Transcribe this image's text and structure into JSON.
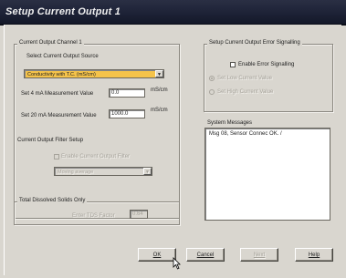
{
  "window": {
    "title": "Setup Current Output 1"
  },
  "channel_group": {
    "label": "Current Output Channel 1",
    "source_label": "Select Current Output Source",
    "source_value": "Conductivity with T.C. (mS/cm)",
    "row_4ma": {
      "label": "Set 4 mA Measurement Value",
      "value": "0.0",
      "unit": "mS/cm"
    },
    "row_20ma": {
      "label": "Set 20 mA Measurement Value",
      "value": "1000.0",
      "unit": "mS/cm"
    }
  },
  "filter_group": {
    "label": "Current Output Filter Setup",
    "checkbox_label": "Enable Current Output Filter",
    "select_value": "Moving average"
  },
  "tds_group": {
    "label": "Total Dissolved Solids Only",
    "factor_label": "Enter TDS Factor",
    "factor_value": "0.64"
  },
  "error_group": {
    "label": "Setup Current Output Error Signalling",
    "enable_label": "Enable Error Signalling",
    "radio1_label": "Set Low Current Value",
    "radio2_label": "Set High Current Value"
  },
  "messages": {
    "label": "System Messages",
    "text": "Msg 08, Sensor Connec OK. /"
  },
  "buttons": {
    "ok": "OK",
    "cancel": "Cancel",
    "next": "Next",
    "help": "Help"
  }
}
